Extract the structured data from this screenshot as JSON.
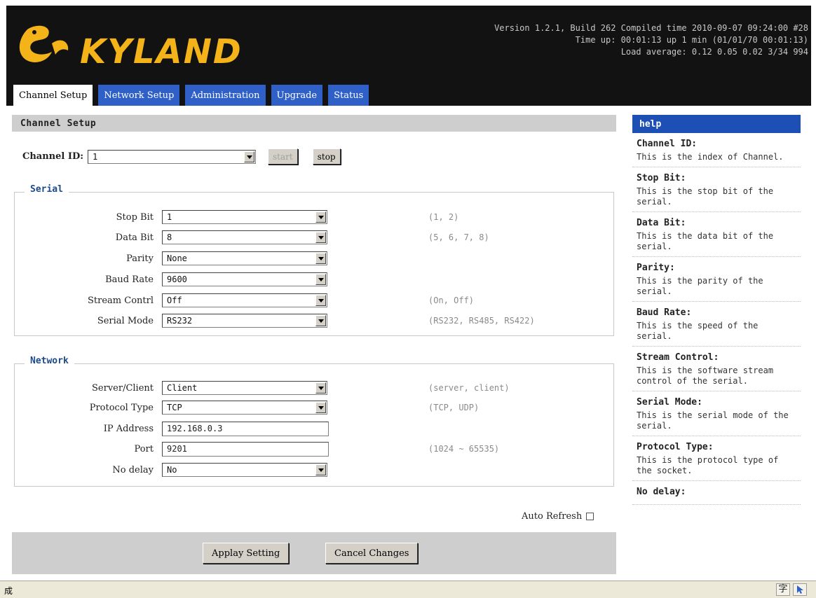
{
  "header": {
    "logo_text": "KYLAND",
    "version_line": "Version 1.2.1, Build 262 Compiled time 2010-09-07 09:24:00 #28",
    "uptime_line": "Time up: 00:01:13 up 1 min (01/01/70 00:01:13)",
    "load_line": "Load average: 0.12 0.05 0.02 3/34 994"
  },
  "tabs": [
    {
      "label": "Channel Setup",
      "active": true
    },
    {
      "label": "Network Setup",
      "active": false
    },
    {
      "label": "Administration",
      "active": false
    },
    {
      "label": "Upgrade",
      "active": false
    },
    {
      "label": "Status",
      "active": false
    }
  ],
  "page": {
    "title": "Channel Setup",
    "channel_label": "Channel ID:",
    "channel_value": "1",
    "start_label": "start",
    "stop_label": "stop"
  },
  "serial": {
    "legend": "Serial",
    "fields": [
      {
        "label": "Stop Bit",
        "value": "1",
        "hint": "(1, 2)"
      },
      {
        "label": "Data Bit",
        "value": "8",
        "hint": "(5, 6, 7, 8)"
      },
      {
        "label": "Parity",
        "value": "None",
        "hint": ""
      },
      {
        "label": "Baud Rate",
        "value": "9600",
        "hint": ""
      },
      {
        "label": "Stream Contrl",
        "value": "Off",
        "hint": "(On, Off)"
      },
      {
        "label": "Serial Mode",
        "value": "RS232",
        "hint": "(RS232, RS485, RS422)"
      }
    ]
  },
  "network": {
    "legend": "Network",
    "fields": [
      {
        "label": "Server/Client",
        "value": "Client",
        "hint": "(server, client)"
      },
      {
        "label": "Protocol Type",
        "value": "TCP",
        "hint": "(TCP, UDP)"
      },
      {
        "label": "IP Address",
        "value": "192.168.0.3",
        "hint": ""
      },
      {
        "label": "Port",
        "value": "9201",
        "hint": "(1024 ~ 65535)"
      },
      {
        "label": "No delay",
        "value": "No",
        "hint": ""
      }
    ]
  },
  "auto_refresh_label": "Auto Refresh",
  "actions": {
    "apply_label": "Applay Setting",
    "cancel_label": "Cancel Changes"
  },
  "help": {
    "title": "help",
    "items": [
      {
        "title": "Channel ID:",
        "text": "This is the index of Channel."
      },
      {
        "title": "Stop Bit:",
        "text": "This is the stop bit of the serial."
      },
      {
        "title": "Data Bit:",
        "text": "This is the data bit of the serial."
      },
      {
        "title": "Parity:",
        "text": "This is the parity of the serial."
      },
      {
        "title": "Baud Rate:",
        "text": "This is the speed of the serial."
      },
      {
        "title": "Stream Control:",
        "text": "This is the software stream control of the serial."
      },
      {
        "title": "Serial Mode:",
        "text": "This is the serial mode of the serial."
      },
      {
        "title": "Protocol Type:",
        "text": "This is the protocol type of the socket."
      },
      {
        "title": "No delay:",
        "text": ""
      }
    ]
  },
  "statusbar": {
    "text": "成",
    "ime_label": "字"
  }
}
